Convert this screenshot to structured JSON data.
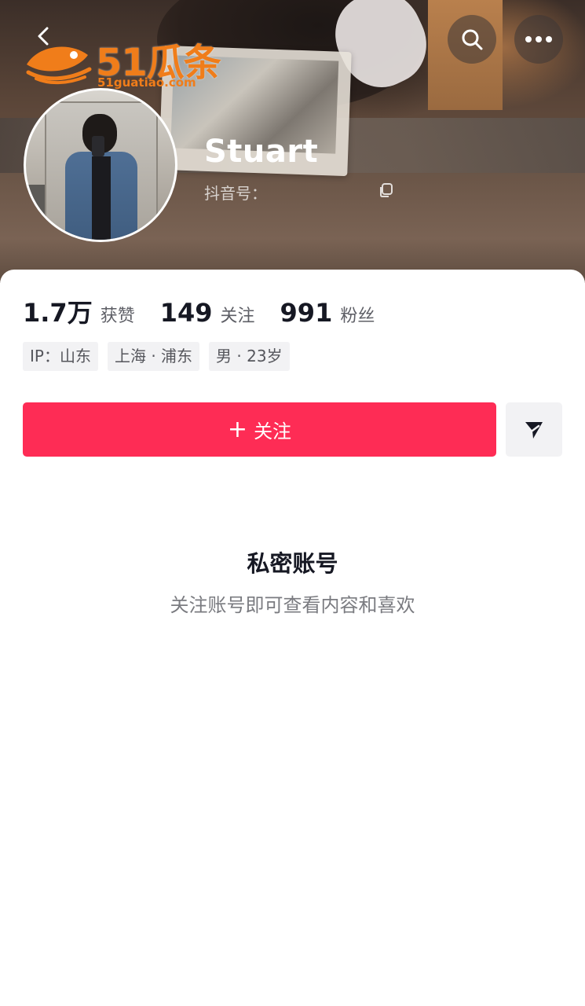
{
  "watermark": {
    "brand": "51瓜条",
    "url": "51guatiao.com"
  },
  "profile": {
    "name": "Stuart",
    "douyin_id_label": "抖音号：",
    "stats": [
      {
        "value": "1.7万",
        "label": "获赞"
      },
      {
        "value": "149",
        "label": "关注"
      },
      {
        "value": "991",
        "label": "粉丝"
      }
    ],
    "tags": [
      "IP：山东",
      "上海 · 浦东",
      "男 · 23岁"
    ]
  },
  "actions": {
    "follow_label": "关注",
    "follow_plus": "+"
  },
  "private": {
    "title": "私密账号",
    "subtitle": "关注账号即可查看内容和喜欢"
  },
  "colors": {
    "accent": "#fe2c55",
    "watermark": "#f07d1a"
  },
  "icons": {
    "back": "chevron-left-icon",
    "search": "search-icon",
    "more": "more-icon",
    "share": "send-icon",
    "copy": "copy-icon"
  }
}
